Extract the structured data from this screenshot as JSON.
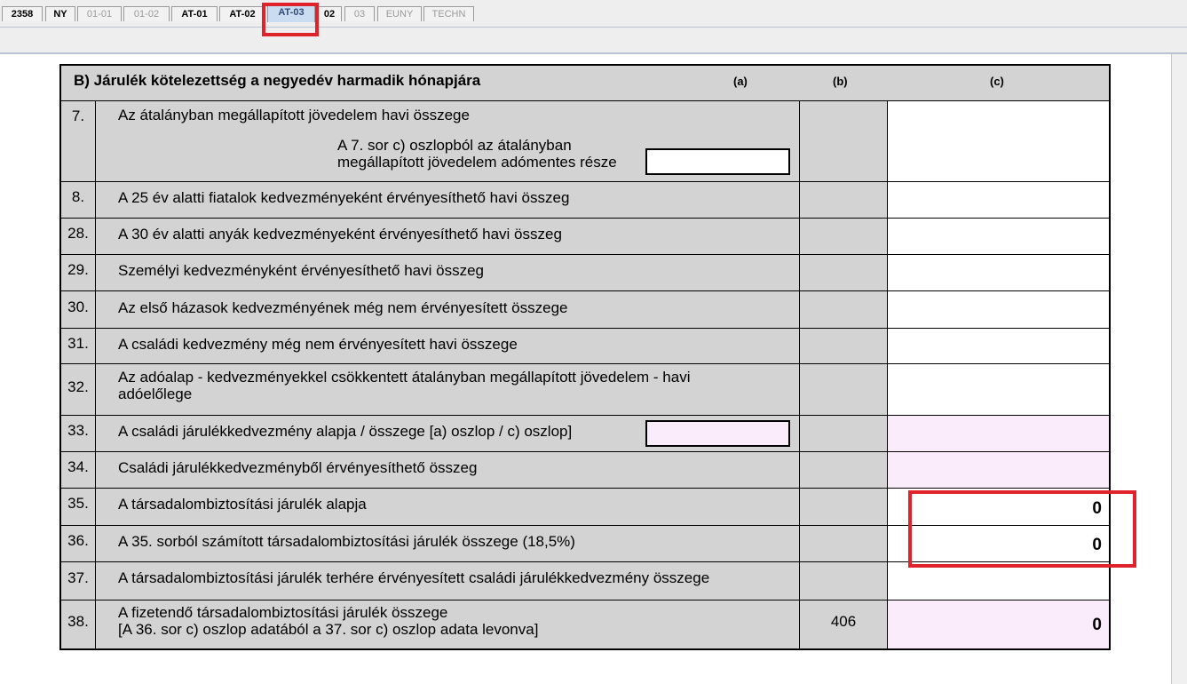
{
  "tabs": [
    {
      "label": "2358",
      "state": "normal"
    },
    {
      "label": "NY",
      "state": "normal"
    },
    {
      "label": "01-01",
      "state": "disabled"
    },
    {
      "label": "01-02",
      "state": "disabled"
    },
    {
      "label": "AT-01",
      "state": "normal"
    },
    {
      "label": "AT-02",
      "state": "normal"
    },
    {
      "label": "AT-03",
      "state": "active"
    },
    {
      "label": "02",
      "state": "normal"
    },
    {
      "label": "03",
      "state": "disabled"
    },
    {
      "label": "EUNY",
      "state": "disabled"
    },
    {
      "label": "TECHN",
      "state": "disabled"
    }
  ],
  "section": {
    "title": "B) Járulék kötelezettség a negyedév harmadik hónapjára",
    "col_a": "(a)",
    "col_b": "(b)",
    "col_c": "(c)"
  },
  "rows": [
    {
      "num": "7.",
      "desc": "Az átalányban megállapított jövedelem havi összege",
      "sub": "A 7. sor c) oszlopból az átalányban megállapított jövedelem adómentes része",
      "b": "",
      "c": ""
    },
    {
      "num": "8.",
      "desc": "A 25 év alatti fiatalok kedvezményeként érvényesíthető havi összeg",
      "b": "",
      "c": ""
    },
    {
      "num": "28.",
      "desc": "A 30 év alatti anyák kedvezményeként érvényesíthető havi összeg",
      "b": "",
      "c": ""
    },
    {
      "num": "29.",
      "desc": "Személyi kedvezményként érvényesíthető havi összeg",
      "b": "",
      "c": ""
    },
    {
      "num": "30.",
      "desc": "Az első házasok kedvezményének még nem érvényesített összege",
      "b": "",
      "c": ""
    },
    {
      "num": "31.",
      "desc": "A családi kedvezmény még nem érvényesített havi összege",
      "b": "",
      "c": ""
    },
    {
      "num": "32.",
      "desc": "Az adóalap - kedvezményekkel csökkentett átalányban megállapított jövedelem - havi adóelőlege",
      "b": "",
      "c": ""
    },
    {
      "num": "33.",
      "desc": "A családi járulékkedvezmény alapja / összege [a) oszlop / c) oszlop]",
      "b": "",
      "c": ""
    },
    {
      "num": "34.",
      "desc": "Családi járulékkedvezményből érvényesíthető összeg",
      "b": "",
      "c": ""
    },
    {
      "num": "35.",
      "desc": "A társadalombiztosítási járulék alapja",
      "b": "",
      "c": "0"
    },
    {
      "num": "36.",
      "desc": "A 35. sorból számított társadalombiztosítási járulék összege (18,5%)",
      "b": "",
      "c": "0"
    },
    {
      "num": "37.",
      "desc": "A társadalombiztosítási járulék terhére érvényesített családi járulékkedvezmény összege",
      "b": "",
      "c": ""
    },
    {
      "num": "38.",
      "desc": "A fizetendő társadalombiztosítási járulék összege",
      "desc2": "[A 36. sor c) oszlop adatából a 37. sor c) oszlop adata levonva]",
      "b": "406",
      "c": "0"
    }
  ],
  "colors": {
    "highlight": "#e0232a",
    "pink_field": "#fbecfb",
    "form_bg": "#d3d3d3"
  }
}
